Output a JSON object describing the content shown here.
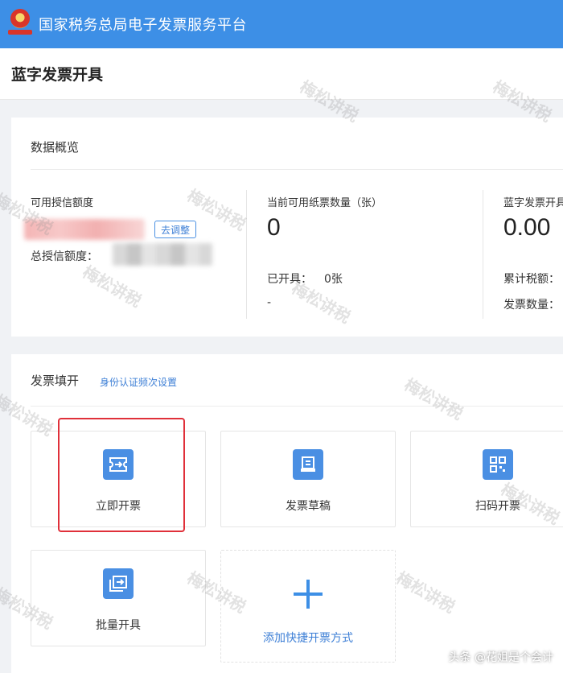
{
  "header": {
    "brand": "国家税务总局电子发票服务平台"
  },
  "page": {
    "title": "蓝字发票开具"
  },
  "overview": {
    "title": "数据概览",
    "credit": {
      "label": "可用授信额度",
      "adjust_label": "去调整",
      "total_label": "总授信额度："
    },
    "paper": {
      "label": "当前可用纸票数量（张）",
      "value": "0",
      "issued_label": "已开具：",
      "issued_value": "0张",
      "extra": "-"
    },
    "blue": {
      "label": "蓝字发票开具",
      "value": "0.00",
      "tax_label": "累计税额：",
      "count_label": "发票数量："
    }
  },
  "fill": {
    "title": "发票填开",
    "auth_link": "身份认证频次设置",
    "tiles": [
      {
        "label": "立即开票",
        "icon": "ticket-icon"
      },
      {
        "label": "发票草稿",
        "icon": "draft-icon"
      },
      {
        "label": "扫码开票",
        "icon": "qrcode-icon"
      },
      {
        "label": "批量开具",
        "icon": "batch-icon"
      }
    ],
    "add_label": "添加快捷开票方式"
  },
  "watermark": "梅松讲税",
  "credit_line": "头条 @花姐是个会计",
  "colors": {
    "accent": "#3d8fe6",
    "highlight": "#e0303a"
  }
}
